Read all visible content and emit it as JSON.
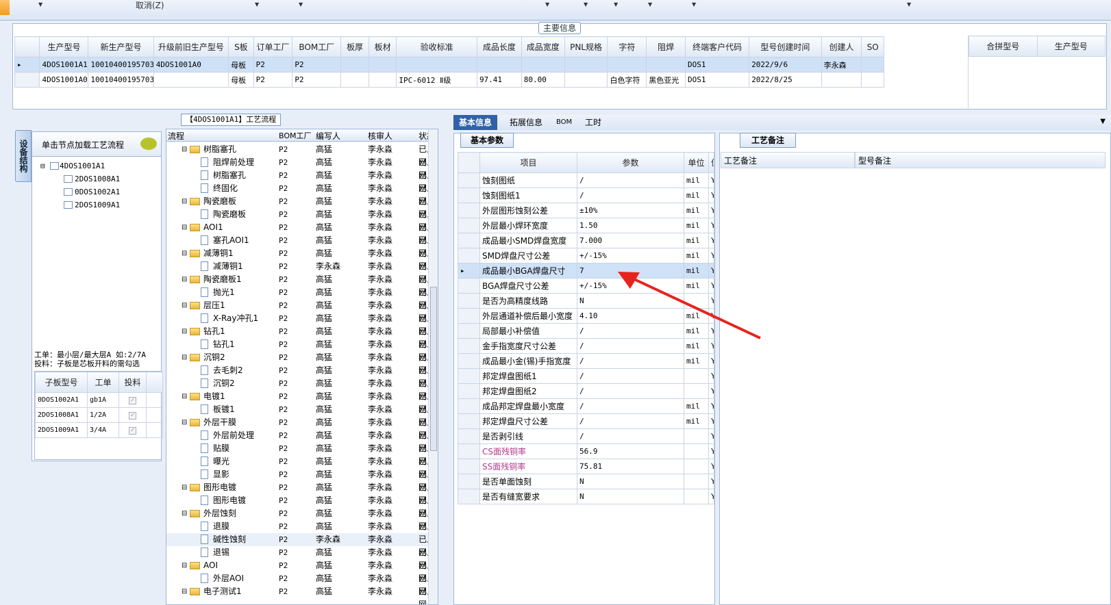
{
  "toolbar": {
    "cancel_label": "取消(Z)"
  },
  "main_info": {
    "title": "主要信息",
    "columns": [
      "生产型号",
      "新生产型号",
      "升级前旧生产型号",
      "S板",
      "订单工厂",
      "BOM工厂",
      "板厚",
      "板材",
      "验收标准",
      "成品长度",
      "成品宽度",
      "PNL规格",
      "字符",
      "阻焊",
      "终端客户代码",
      "型号创建时间",
      "创建人",
      "SO"
    ],
    "rows": [
      [
        "4DOS1001A1",
        "10010400195703",
        "4DOS1001A0",
        "母板",
        "P2",
        "P2",
        "",
        "",
        "",
        "",
        "",
        "",
        "",
        "",
        "DOS1",
        "2022/9/6",
        "李永森",
        ""
      ],
      [
        "4DOS1001A0",
        "10010400195703",
        "",
        "母板",
        "P2",
        "P2",
        "",
        "",
        "IPC-6012 Ⅱ级",
        "97.41",
        "80.00",
        "",
        "白色字符",
        "黑色亚光",
        "DOS1",
        "2022/8/25",
        "",
        ""
      ]
    ],
    "merge_columns": [
      "合拼型号",
      "生产型号"
    ]
  },
  "left": {
    "side_tab": "设备结构",
    "click_hint": "单击节点加载工艺流程",
    "tree_root": "4DOS1001A1",
    "tree_children": [
      "2DOS1008A1",
      "0DOS1002A1",
      "2DOS1009A1"
    ],
    "note_line1": "工单：最小层/最大层A 如:2/7A",
    "note_line2": "投料：子板是芯板开料的需勾选",
    "sub_columns": [
      "子板型号",
      "工单",
      "投料"
    ],
    "sub_rows": [
      [
        "0DOS1002A1",
        "gb1A"
      ],
      [
        "2DOS1008A1",
        "1/2A"
      ],
      [
        "2DOS1009A1",
        "3/4A"
      ]
    ]
  },
  "process": {
    "title": "【4DOS1001A1】工艺流程",
    "headers": [
      "流程",
      "BOM工厂",
      "编写人",
      "核审人",
      "状态"
    ],
    "rows": [
      {
        "name": "树脂塞孔",
        "f": 1,
        "bom": "P2",
        "w": "高猛",
        "r": "李永淼",
        "s": "已上网"
      },
      {
        "name": "阻焊前处理",
        "f": 0,
        "bom": "P2",
        "w": "高猛",
        "r": "李永淼",
        "s": "已上网"
      },
      {
        "name": "树脂塞孔",
        "f": 0,
        "bom": "P2",
        "w": "高猛",
        "r": "李永淼",
        "s": "已上网"
      },
      {
        "name": "终固化",
        "f": 0,
        "bom": "P2",
        "w": "高猛",
        "r": "李永淼",
        "s": "已上网"
      },
      {
        "name": "陶瓷磨板",
        "f": 1,
        "bom": "P2",
        "w": "高猛",
        "r": "李永淼",
        "s": "已上网"
      },
      {
        "name": "陶瓷磨板",
        "f": 0,
        "bom": "P2",
        "w": "高猛",
        "r": "李永淼",
        "s": "已上网"
      },
      {
        "name": "AOI1",
        "f": 1,
        "bom": "P2",
        "w": "高猛",
        "r": "李永淼",
        "s": "已上网"
      },
      {
        "name": "塞孔AOI1",
        "f": 0,
        "bom": "P2",
        "w": "高猛",
        "r": "李永淼",
        "s": "已上网"
      },
      {
        "name": "减薄铜1",
        "f": 1,
        "bom": "P2",
        "w": "高猛",
        "r": "李永淼",
        "s": "已上网"
      },
      {
        "name": "减薄铜1",
        "f": 0,
        "bom": "P2",
        "w": "李永森",
        "r": "李永淼",
        "s": "已上网"
      },
      {
        "name": "陶瓷磨板1",
        "f": 1,
        "bom": "P2",
        "w": "高猛",
        "r": "李永淼",
        "s": "已上网"
      },
      {
        "name": "抛光1",
        "f": 0,
        "bom": "P2",
        "w": "高猛",
        "r": "李永淼",
        "s": "已上网"
      },
      {
        "name": "层压1",
        "f": 1,
        "bom": "P2",
        "w": "高猛",
        "r": "李永淼",
        "s": "已上网"
      },
      {
        "name": "X-Ray冲孔1",
        "f": 0,
        "bom": "P2",
        "w": "高猛",
        "r": "李永淼",
        "s": "已上网"
      },
      {
        "name": "钻孔1",
        "f": 1,
        "bom": "P2",
        "w": "高猛",
        "r": "李永淼",
        "s": "已上网"
      },
      {
        "name": "钻孔1",
        "f": 0,
        "bom": "P2",
        "w": "高猛",
        "r": "李永淼",
        "s": "已上网"
      },
      {
        "name": "沉铜2",
        "f": 1,
        "bom": "P2",
        "w": "高猛",
        "r": "李永淼",
        "s": "已上网"
      },
      {
        "name": "去毛刺2",
        "f": 0,
        "bom": "P2",
        "w": "高猛",
        "r": "李永淼",
        "s": "已上网"
      },
      {
        "name": "沉铜2",
        "f": 0,
        "bom": "P2",
        "w": "高猛",
        "r": "李永淼",
        "s": "已上网"
      },
      {
        "name": "电镀1",
        "f": 1,
        "bom": "P2",
        "w": "高猛",
        "r": "李永淼",
        "s": "已上网"
      },
      {
        "name": "板镀1",
        "f": 0,
        "bom": "P2",
        "w": "高猛",
        "r": "李永淼",
        "s": "已上网"
      },
      {
        "name": "外层干膜",
        "f": 1,
        "bom": "P2",
        "w": "高猛",
        "r": "李永淼",
        "s": "已上网"
      },
      {
        "name": "外层前处理",
        "f": 0,
        "bom": "P2",
        "w": "高猛",
        "r": "李永淼",
        "s": "已上网"
      },
      {
        "name": "贴膜",
        "f": 0,
        "bom": "P2",
        "w": "高猛",
        "r": "李永淼",
        "s": "已上网"
      },
      {
        "name": "曝光",
        "f": 0,
        "bom": "P2",
        "w": "高猛",
        "r": "李永淼",
        "s": "已上网"
      },
      {
        "name": "显影",
        "f": 0,
        "bom": "P2",
        "w": "高猛",
        "r": "李永淼",
        "s": "已上网"
      },
      {
        "name": "图形电镀",
        "f": 1,
        "bom": "P2",
        "w": "高猛",
        "r": "李永淼",
        "s": "已上网"
      },
      {
        "name": "图形电镀",
        "f": 0,
        "bom": "P2",
        "w": "高猛",
        "r": "李永淼",
        "s": "已上网"
      },
      {
        "name": "外层蚀刻",
        "f": 1,
        "bom": "P2",
        "w": "高猛",
        "r": "李永淼",
        "s": "已上网"
      },
      {
        "name": "退膜",
        "f": 0,
        "bom": "P2",
        "w": "高猛",
        "r": "李永淼",
        "s": "已上网"
      },
      {
        "name": "碱性蚀刻",
        "f": 0,
        "bom": "P2",
        "w": "李永森",
        "r": "李永淼",
        "s": "已上网"
      },
      {
        "name": "退锡",
        "f": 0,
        "bom": "P2",
        "w": "高猛",
        "r": "李永淼",
        "s": "已上网"
      },
      {
        "name": "AOI",
        "f": 1,
        "bom": "P2",
        "w": "高猛",
        "r": "李永淼",
        "s": "已上网"
      },
      {
        "name": "外层AOI",
        "f": 0,
        "bom": "P2",
        "w": "高猛",
        "r": "李永淼",
        "s": "已上网"
      },
      {
        "name": "电子测试1",
        "f": 1,
        "bom": "P2",
        "w": "高猛",
        "r": "李永淼",
        "s": "已上网"
      }
    ]
  },
  "tabs": [
    "基本信息",
    "拓展信息",
    "BOM",
    "工时"
  ],
  "params": {
    "subtab": "基本参数",
    "headers": [
      "项目",
      "参数",
      "单位",
      "值"
    ],
    "rows": [
      [
        "蚀刻图纸",
        "/",
        "mil",
        "Y"
      ],
      [
        "蚀刻图纸1",
        "/",
        "mil",
        "Y"
      ],
      [
        "外层图形蚀刻公差",
        "±10%",
        "mil",
        "Y"
      ],
      [
        "外层最小焊环宽度",
        "1.50",
        "mil",
        "Y"
      ],
      [
        "成品最小SMD焊盘宽度",
        "7.000",
        "mil",
        "Y"
      ],
      [
        "SMD焊盘尺寸公差",
        "+/-15%",
        "mil",
        "Y"
      ],
      [
        "成品最小BGA焊盘尺寸",
        "7",
        "mil",
        "Y"
      ],
      [
        "BGA焊盘尺寸公差",
        "+/-15%",
        "mil",
        "Y"
      ],
      [
        "是否为高精度线路",
        "N",
        "",
        "Y"
      ],
      [
        "外层通道补偿后最小宽度",
        "4.10",
        "mil",
        "Y"
      ],
      [
        "局部最小补偿值",
        "/",
        "mil",
        "Y"
      ],
      [
        "金手指宽度尺寸公差",
        "/",
        "mil",
        "Y"
      ],
      [
        "成品最小金(锡)手指宽度",
        "/",
        "mil",
        "Y"
      ],
      [
        "邦定焊盘图纸1",
        "/",
        "",
        "Y"
      ],
      [
        "邦定焊盘图纸2",
        "/",
        "",
        "Y"
      ],
      [
        "成品邦定焊盘最小宽度",
        "/",
        "mil",
        "Y"
      ],
      [
        "邦定焊盘尺寸公差",
        "/",
        "mil",
        "Y"
      ],
      [
        "是否剥引线",
        "/",
        "",
        "Y"
      ],
      [
        "CS面残铜率",
        "56.9",
        "",
        "Y"
      ],
      [
        "SS面残铜率",
        "75.81",
        "",
        "Y"
      ],
      [
        "是否单面蚀刻",
        "N",
        "",
        "Y"
      ],
      [
        "是否有缝宽要求",
        "N",
        "",
        "Y"
      ]
    ]
  },
  "remarks": {
    "tab": "工艺备注",
    "col1": "工艺备注",
    "col2": "型号备注"
  },
  "colors": {
    "accent": "#2f62a8",
    "selection": "#cfe1f7",
    "arrow": "#e8231e"
  }
}
